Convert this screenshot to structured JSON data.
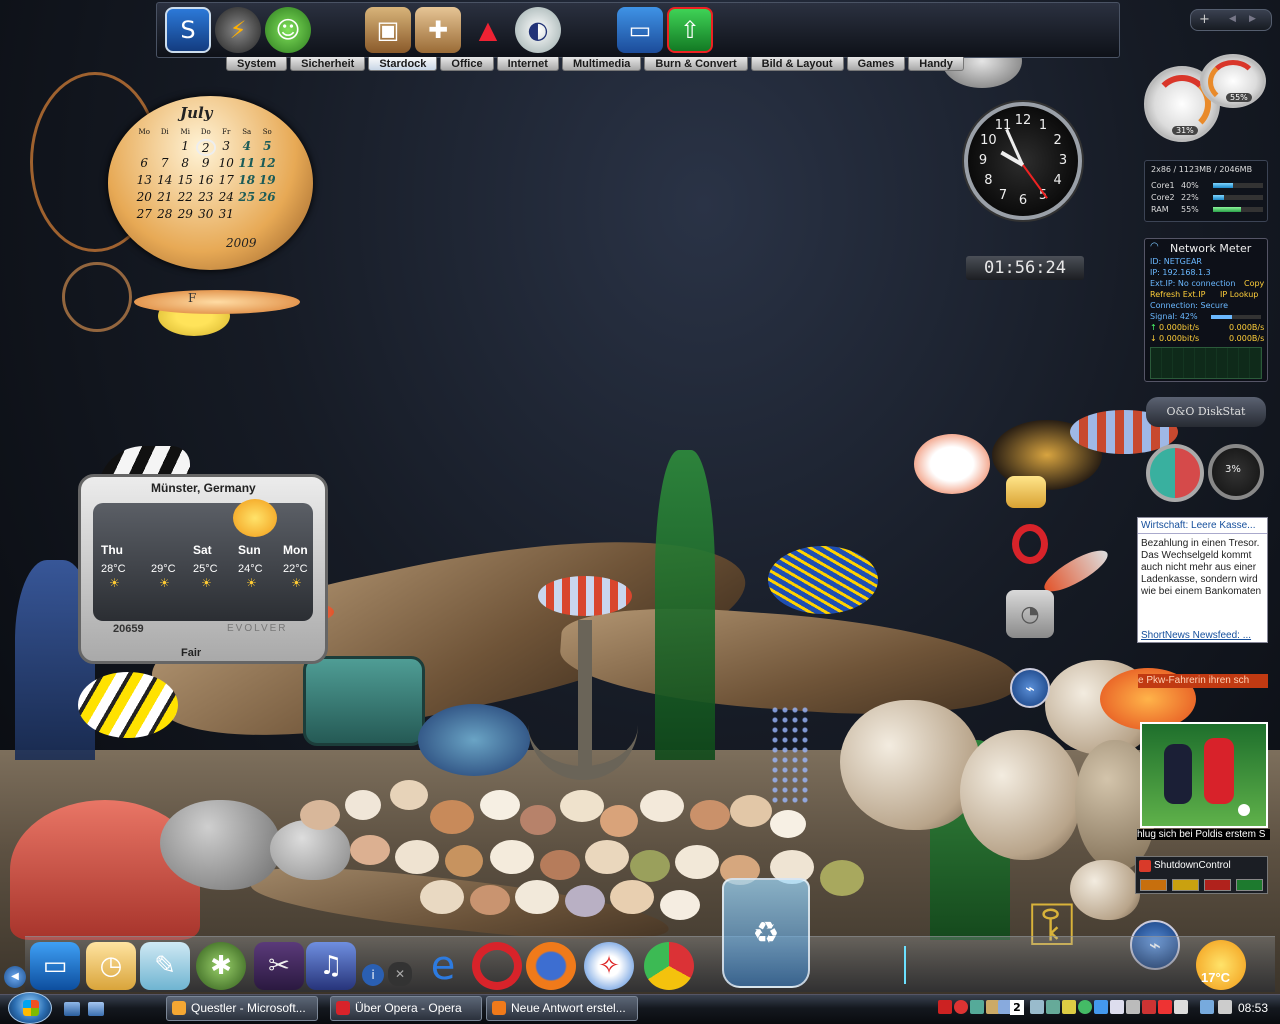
{
  "launcher": {
    "tabs": [
      "System",
      "Sicherheit",
      "Stardock",
      "Office",
      "Internet",
      "Multimedia",
      "Burn & Convert",
      "Bild & Layout",
      "Games",
      "Handy"
    ],
    "active_tab": "Stardock"
  },
  "calendar": {
    "month": "July",
    "year": "2009",
    "weekdays": [
      "Mo",
      "Di",
      "Mi",
      "Do",
      "Fr",
      "Sa",
      "So"
    ],
    "weeks": [
      [
        "",
        "",
        "1",
        "2",
        "3",
        "4",
        "5"
      ],
      [
        "6",
        "7",
        "8",
        "9",
        "10",
        "11",
        "12"
      ],
      [
        "13",
        "14",
        "15",
        "16",
        "17",
        "18",
        "19"
      ],
      [
        "20",
        "21",
        "22",
        "23",
        "24",
        "25",
        "26"
      ],
      [
        "27",
        "28",
        "29",
        "30",
        "31",
        "",
        ""
      ]
    ],
    "today": "2"
  },
  "calendar_extra": {
    "label": "F"
  },
  "clock": {
    "numbers": [
      "12",
      "1",
      "2",
      "3",
      "4",
      "5",
      "6",
      "7",
      "8",
      "9",
      "10",
      "11"
    ],
    "digital": "01:56:24"
  },
  "gauges": {
    "cpu": "31%",
    "memory": "55%"
  },
  "sysmeter": {
    "header": "2x86 / 1123MB / 2046MB",
    "rows": [
      {
        "label": "Core1",
        "value": "40%",
        "fill": 0.4
      },
      {
        "label": "Core2",
        "value": "22%",
        "fill": 0.22
      },
      {
        "label": "RAM",
        "value": "55%",
        "fill": 0.55
      }
    ]
  },
  "netmeter": {
    "title": "Network Meter",
    "id": "ID: NETGEAR",
    "ip": "IP: 192.168.1.3",
    "ext_ip": "Ext.IP: No connection",
    "copy": "Copy",
    "refresh": "Refresh Ext.IP",
    "lookup": "IP Lookup",
    "connection": "Connection: Secure",
    "signal": "Signal: 42%",
    "signal_fill": 0.42,
    "up_bits": "0.000bit/s",
    "up_bytes": "0.000B/s",
    "down_bits": "0.000bit/s",
    "down_bytes": "0.000B/s"
  },
  "diskstat": {
    "title": "O&O DiskStat",
    "value": "3%"
  },
  "news": {
    "headline": "Wirtschaft: Leere Kasse...",
    "body": "Bezahlung in einen Tresor. Das Wechselgeld kommt auch nicht mehr aus einer Ladenkasse, sondern wird wie bei einem Bankomaten",
    "footer": "ShortNews Newsfeed: ..."
  },
  "ticker": {
    "text": "e Pkw-Fahrerin ihren sch"
  },
  "photo": {
    "caption": "hlug sich bei Poldis erstem S"
  },
  "shutdown": {
    "title": "ShutdownControl"
  },
  "weather": {
    "location": "Münster, Germany",
    "days": [
      {
        "day": "Thu",
        "temp": "28°C"
      },
      {
        "day": "",
        "temp": "29°C"
      },
      {
        "day": "Sat",
        "temp": "25°C"
      },
      {
        "day": "Sun",
        "temp": "24°C"
      },
      {
        "day": "Mon",
        "temp": "22°C"
      }
    ],
    "code": "20659",
    "brand": "EVOLVER",
    "condition": "Fair"
  },
  "dock": {
    "temp": "17°C"
  },
  "taskbar": {
    "tasks": [
      "Questler - Microsoft...",
      "Über Opera - Opera",
      "Neue Antwort erstel..."
    ],
    "time": "08:53",
    "tray_number": "2"
  },
  "colors": {
    "accent_blue": "#2c6fb3",
    "news_link": "#154f9c",
    "ticker_bg": "#c13a12"
  }
}
